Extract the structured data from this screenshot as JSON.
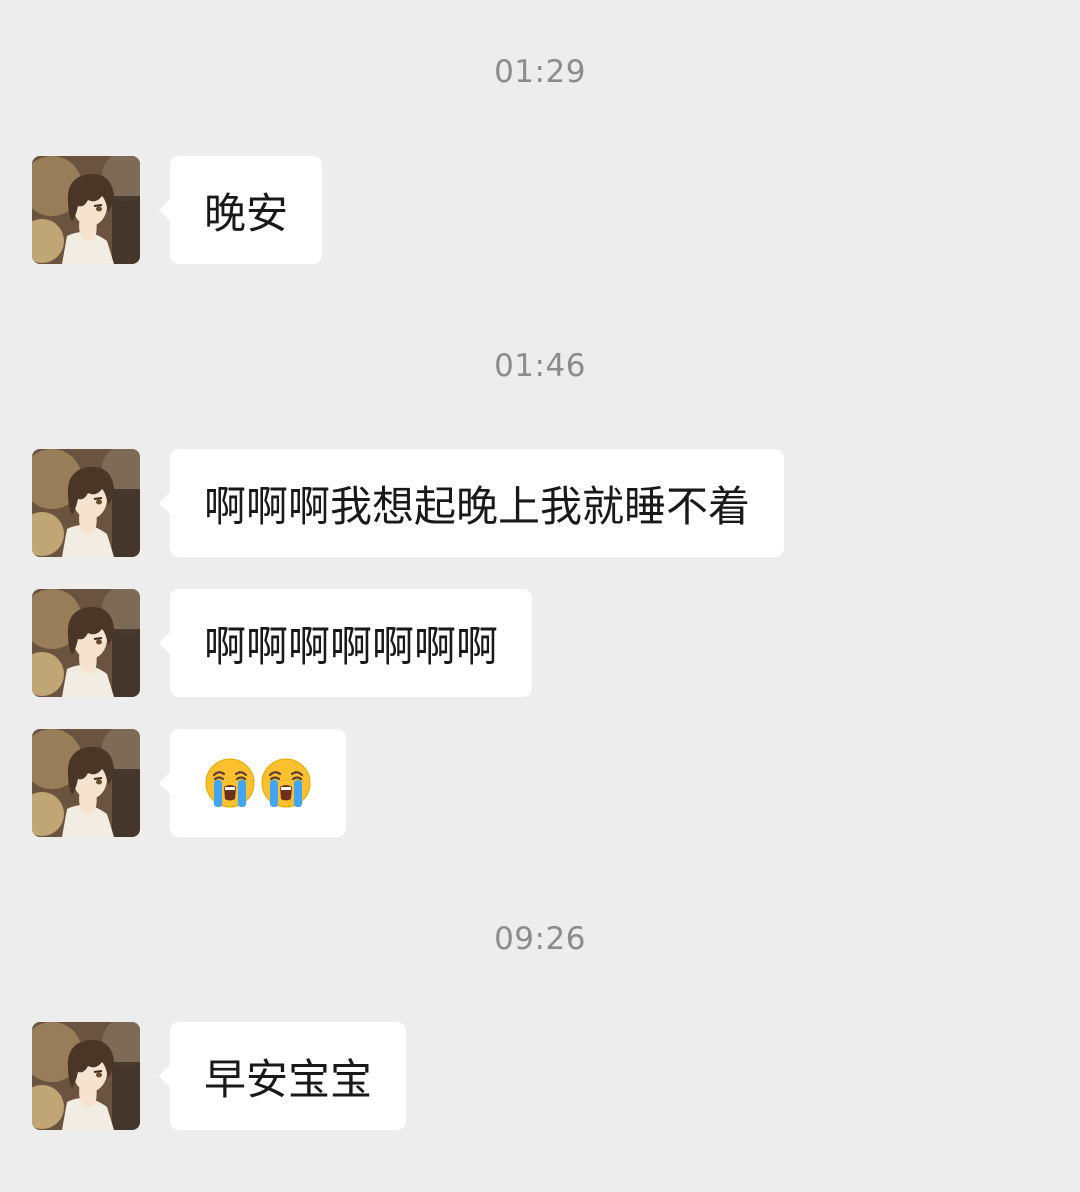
{
  "chat": {
    "timestamps": [
      "01:29",
      "01:46",
      "09:26"
    ],
    "messages": [
      {
        "sender": "contact",
        "text": "晚安"
      },
      {
        "sender": "contact",
        "text": "啊啊啊我想起晚上我就睡不着"
      },
      {
        "sender": "contact",
        "text": "啊啊啊啊啊啊啊"
      },
      {
        "sender": "contact",
        "emoji": [
          "loudly-crying-face",
          "loudly-crying-face"
        ]
      },
      {
        "sender": "contact",
        "text": "早安宝宝"
      }
    ],
    "avatar_icon": "anime-boy-avatar",
    "colors": {
      "background": "#ededed",
      "bubble": "#ffffff",
      "text": "#191919",
      "timestamp": "#8c8c8c"
    }
  }
}
